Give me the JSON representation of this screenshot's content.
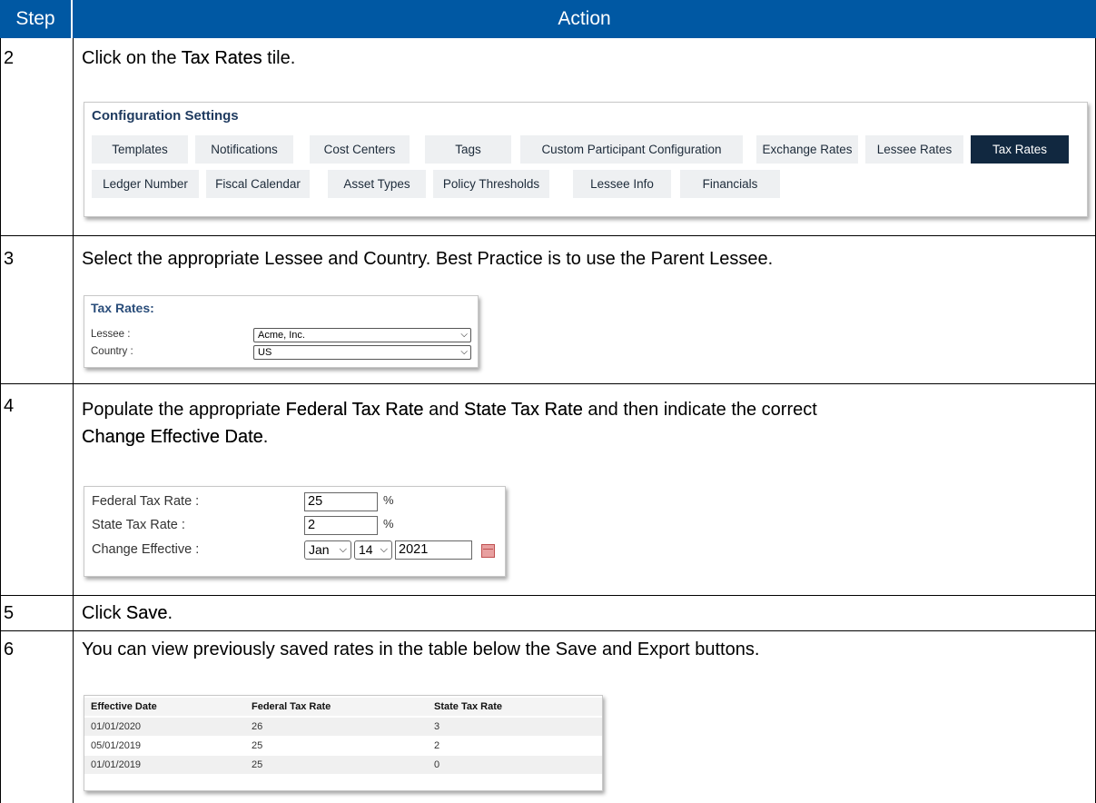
{
  "header": {
    "step": "Step",
    "action": "Action"
  },
  "steps": [
    {
      "num": "2",
      "pre": "Click on the ",
      "bold1": "Tax Rates",
      "post": " tile."
    },
    {
      "num": "3",
      "text": "Select the appropriate Lessee and Country. Best Practice is to use the Parent Lessee."
    },
    {
      "num": "4",
      "pre": "Populate the appropriate ",
      "bold1": "Federal Tax Rate",
      "mid": " and ",
      "bold2": "State Tax Rate",
      "post": " and then indicate the correct",
      "bold3": "Change Effective Date",
      "end": "."
    },
    {
      "num": "5",
      "pre": "Click ",
      "bold1": "Save",
      "post": "."
    },
    {
      "num": "6",
      "text": "You can view previously saved rates in the table below the Save and Export buttons."
    }
  ],
  "config": {
    "title": "Configuration Settings",
    "row1": [
      "Templates",
      "Notifications",
      "Cost Centers",
      "Tags",
      "Custom Participant Configuration",
      "Exchange Rates",
      "Lessee Rates",
      "Tax Rates"
    ],
    "row2": [
      "Ledger Number",
      "Fiscal Calendar",
      "Asset Types",
      "Policy Thresholds",
      "Lessee Info",
      "Financials"
    ],
    "active": "Tax Rates"
  },
  "tax_rates_form": {
    "title": "Tax Rates:",
    "lessee_label": "Lessee :",
    "lessee_value": "Acme, Inc.",
    "country_label": "Country :",
    "country_value": "US"
  },
  "rate_form": {
    "federal_label": "Federal Tax Rate :",
    "federal_value": "25",
    "state_label": "State Tax Rate :",
    "state_value": "2",
    "pct": "%",
    "change_label": "Change Effective :",
    "month": "Jan",
    "day": "14",
    "year": "2021"
  },
  "rates_table": {
    "headers": [
      "Effective Date",
      "Federal Tax Rate",
      "State Tax Rate"
    ],
    "rows": [
      [
        "01/01/2020",
        "26",
        "3"
      ],
      [
        "05/01/2019",
        "25",
        "2"
      ],
      [
        "01/01/2019",
        "25",
        "0"
      ]
    ]
  }
}
